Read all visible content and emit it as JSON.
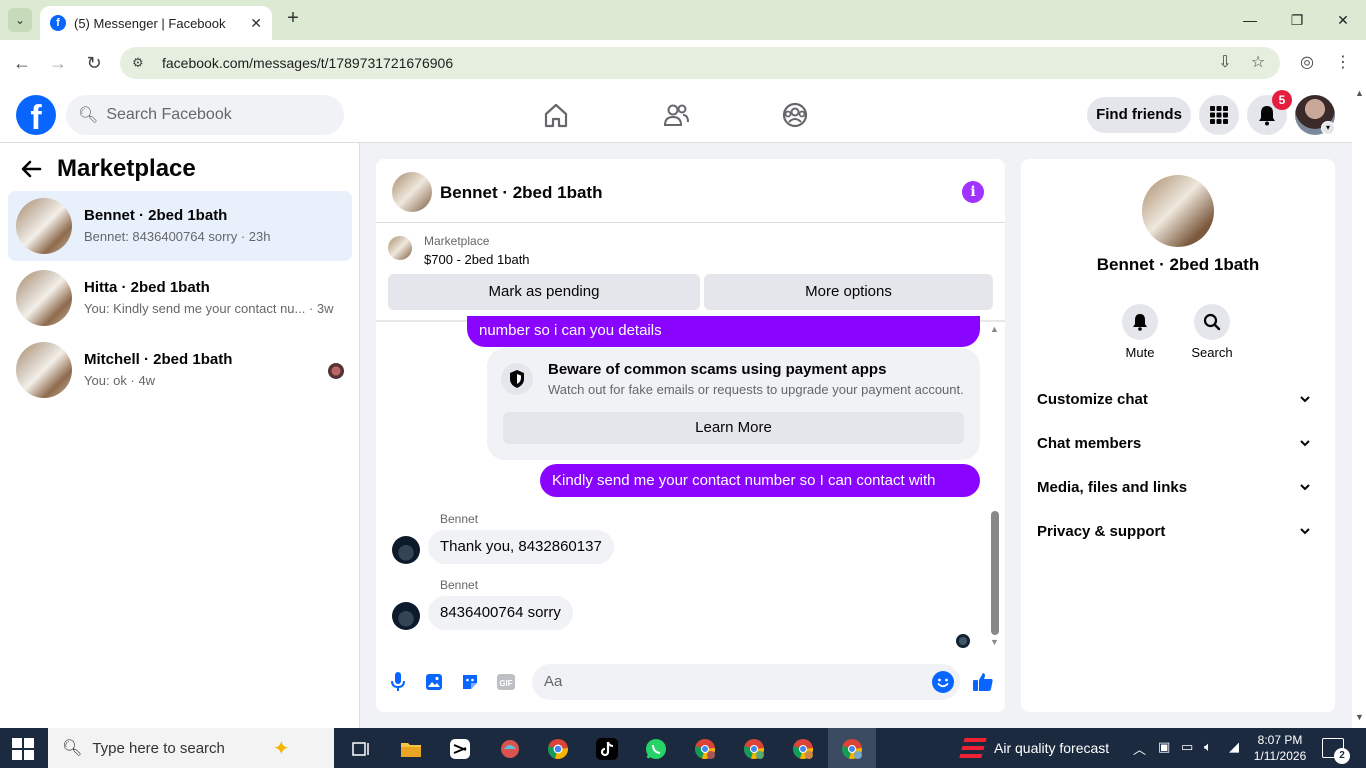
{
  "browser": {
    "tab_title": "(5) Messenger | Facebook",
    "url": "facebook.com/messages/t/1789731721676906"
  },
  "header": {
    "search_placeholder": "Search Facebook",
    "find_friends": "Find friends",
    "notification_count": "5",
    "brand_color": "#0866ff"
  },
  "sidebar": {
    "title": "Marketplace",
    "conversations": [
      {
        "name": "Bennet · 2bed 1bath",
        "preview": "Bennet: 8436400764 sorry · 23h",
        "active": true
      },
      {
        "name": "Hitta · 2bed 1bath",
        "preview": "You: Kindly send me your contact nu...  · 3w",
        "active": false
      },
      {
        "name": "Mitchell · 2bed 1bath",
        "preview": "You: ok · 4w",
        "active": false
      }
    ]
  },
  "chat": {
    "title": "Bennet · 2bed 1bath",
    "listing": {
      "kicker": "Marketplace",
      "title": "$700 - 2bed 1bath"
    },
    "buttons": {
      "mark_pending": "Mark as pending",
      "more_options": "More options"
    },
    "messages": {
      "partial_out": "number so i can you details",
      "scam_title": "Beware of common scams using payment apps",
      "scam_body": "Watch out for fake emails or requests to upgrade your payment account.",
      "learn_more": "Learn More",
      "out2": "Kindly send me your contact number so I can contact with you.",
      "in1_sender": "Bennet",
      "in1_text": "Thank you, 8432860137",
      "in2_sender": "Bennet",
      "in2_text": "8436400764 sorry"
    },
    "composer_placeholder": "Aa",
    "accent_color": "#8a05ff"
  },
  "info_panel": {
    "name": "Bennet · 2bed 1bath",
    "actions": [
      {
        "label": "Mute",
        "icon": "bell-icon"
      },
      {
        "label": "Search",
        "icon": "search-icon"
      }
    ],
    "sections": [
      {
        "label": "Customize chat"
      },
      {
        "label": "Chat members"
      },
      {
        "label": "Media, files and links"
      },
      {
        "label": "Privacy & support"
      }
    ]
  },
  "taskbar": {
    "search_placeholder": "Type here to search",
    "weather": "Air quality forecast",
    "time": "8:07 PM",
    "date": "1/11/2026",
    "notification_count": "2"
  }
}
